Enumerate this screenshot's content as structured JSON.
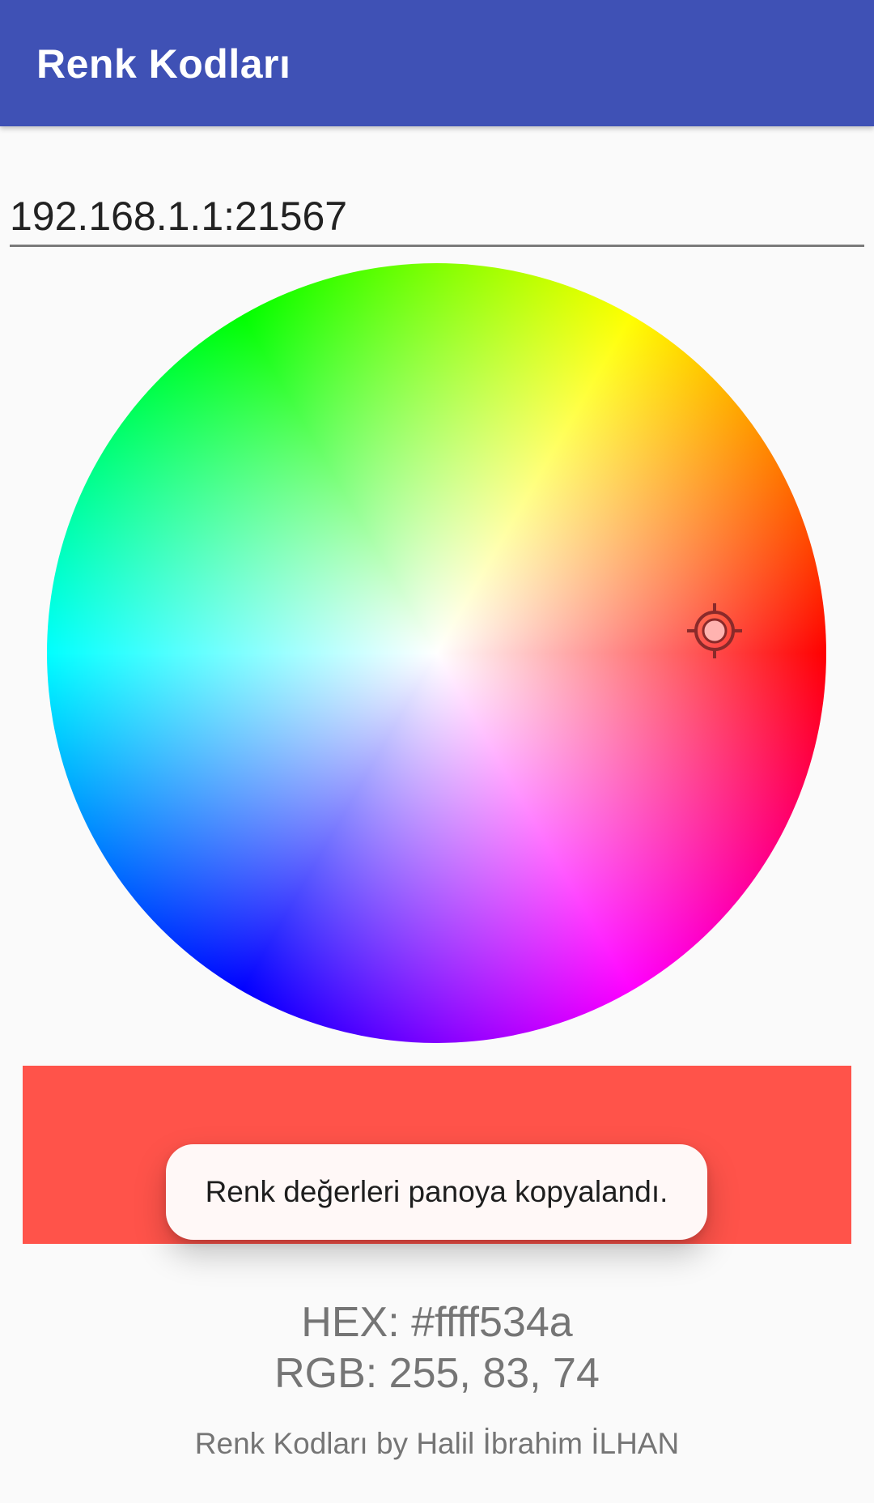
{
  "app_bar": {
    "title": "Renk Kodları",
    "background": "#3f51b5"
  },
  "ip_field": {
    "value": "192.168.1.1:21567"
  },
  "color_wheel": {
    "picker_icon": "crosshair-target-icon",
    "selected_color": "#ff534a"
  },
  "toast": {
    "message": "Renk değerleri panoya kopyalandı."
  },
  "color_info": {
    "hex_line": "HEX: #ffff534a",
    "rgb_line": "RGB: 255, 83, 74"
  },
  "footer": {
    "credit": "Renk Kodları by Halil İbrahim İLHAN"
  }
}
